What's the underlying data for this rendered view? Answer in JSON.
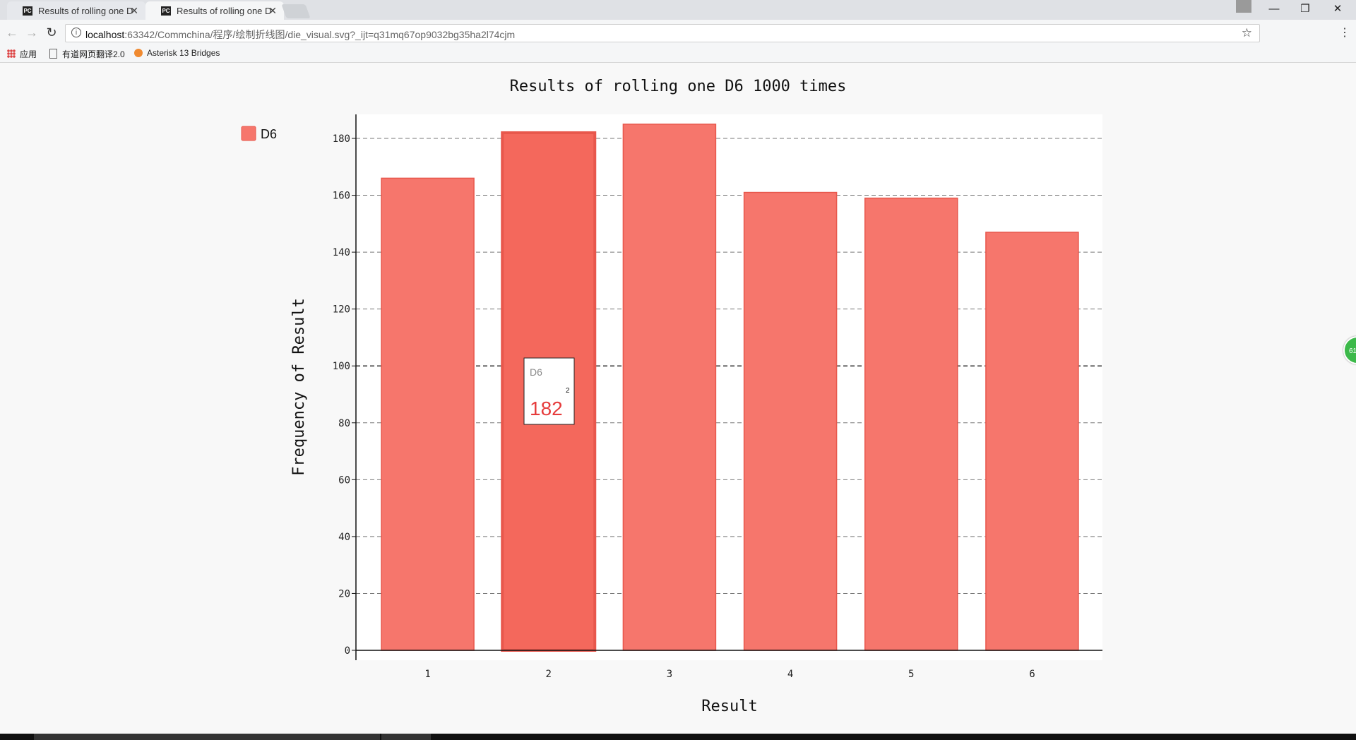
{
  "browser": {
    "tabs": [
      {
        "title": "Results of rolling one D",
        "favicon": "PC"
      },
      {
        "title": "Results of rolling one D",
        "favicon": "PC"
      }
    ],
    "url_host": "localhost",
    "url_rest": ":63342/Commchina/程序/绘制折线图/die_visual.svg?_ijt=q31mq67op9032bg35ha2l74cjm",
    "bookmarks": [
      "应用",
      "有道网页翻译2.0",
      "Asterisk 13 Bridges"
    ],
    "badge_text": "61"
  },
  "chart_data": {
    "type": "bar",
    "title": "Results of rolling one D6 1000 times",
    "xlabel": "Result",
    "ylabel": "Frequency of Result",
    "categories": [
      "1",
      "2",
      "3",
      "4",
      "5",
      "6"
    ],
    "series": [
      {
        "name": "D6",
        "values": [
          166,
          182,
          185,
          161,
          159,
          147
        ]
      }
    ],
    "ylim": [
      0,
      190
    ],
    "yticks": [
      0,
      20,
      40,
      60,
      80,
      100,
      120,
      140,
      160,
      180
    ],
    "grid": true,
    "legend": "top-left",
    "bar_color": "#f6766c",
    "bar_border": "#e8574c",
    "highlight_color": "#f4685c",
    "tooltip": {
      "series": "D6",
      "value": "182",
      "category": "2"
    }
  }
}
